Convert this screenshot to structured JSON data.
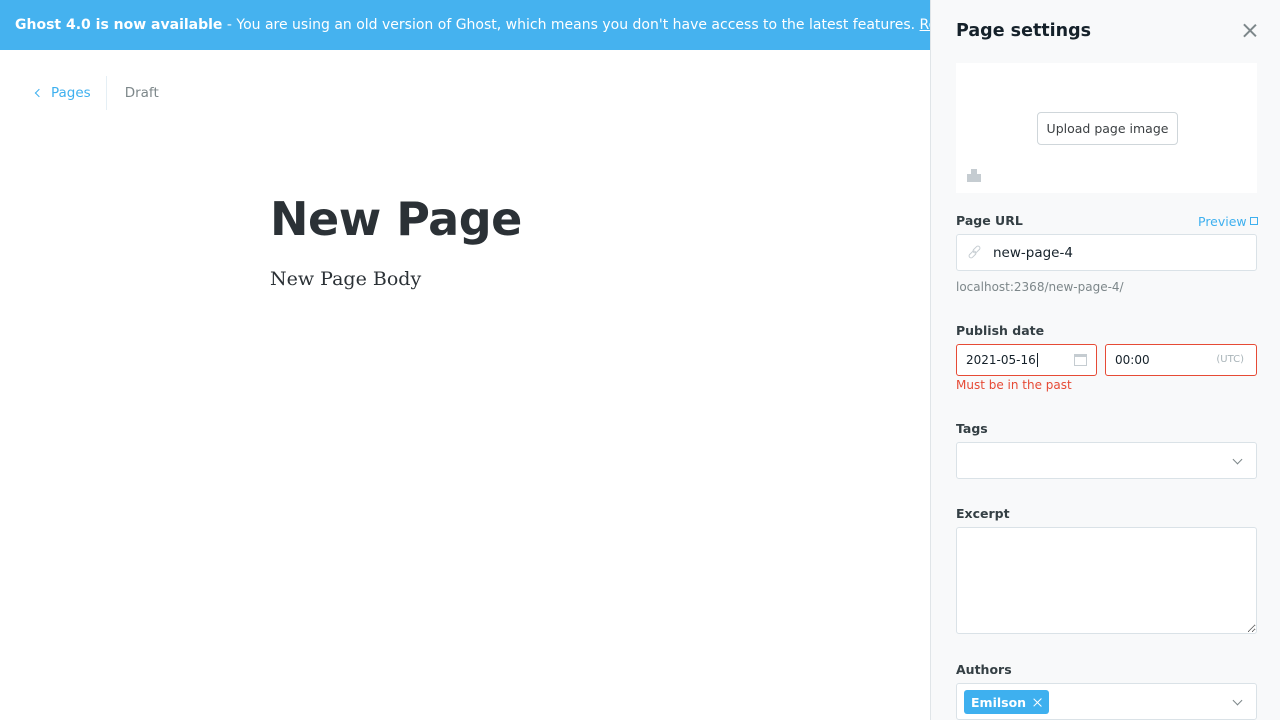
{
  "banner": {
    "bold": "Ghost 4.0 is now available",
    "text": " - You are using an old version of Ghost, which means you don't have access to the latest features. ",
    "link": "Read more!"
  },
  "breadcrumb": {
    "back_label": "Pages",
    "status": "Draft"
  },
  "editor": {
    "title": "New Page",
    "body": "New Page Body"
  },
  "settings": {
    "title": "Page settings",
    "upload_label": "Upload page image",
    "url": {
      "label": "Page URL",
      "preview_label": "Preview",
      "value": "new-page-4",
      "hint": "localhost:2368/new-page-4/"
    },
    "publish": {
      "label": "Publish date",
      "date": "2021-05-16",
      "time": "00:00",
      "tz": "(UTC)",
      "error": "Must be in the past"
    },
    "tags": {
      "label": "Tags"
    },
    "excerpt": {
      "label": "Excerpt",
      "value": ""
    },
    "authors": {
      "label": "Authors",
      "items": [
        "Emilson"
      ]
    }
  },
  "colors": {
    "accent": "#3eb0ef",
    "banner": "#45b2ef",
    "error": "#e64a35"
  }
}
